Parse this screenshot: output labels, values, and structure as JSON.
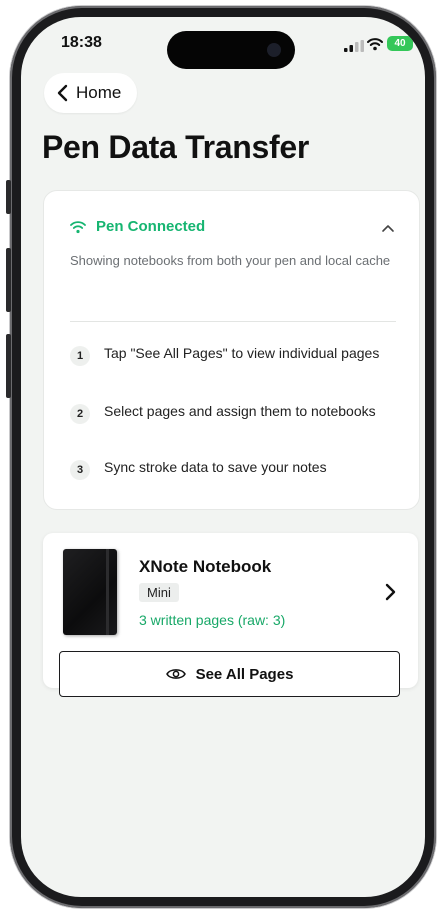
{
  "status_bar": {
    "time": "18:38",
    "battery": "40"
  },
  "header": {
    "back_label": "Home",
    "title": "Pen Data Transfer"
  },
  "connection_card": {
    "status_label": "Pen Connected",
    "status_color": "#16b571",
    "description": "Showing notebooks from both your pen and local cache",
    "steps": [
      {
        "number": "1",
        "text": "Tap \"See All Pages\" to view individual pages"
      },
      {
        "number": "2",
        "text": "Select pages and assign them to notebooks"
      },
      {
        "number": "3",
        "text": "Sync stroke data to save your notes"
      }
    ]
  },
  "notebook": {
    "title": "XNote Notebook",
    "size_badge": "Mini",
    "pages_info": "3 written pages (raw: 3)",
    "see_all_label": "See All Pages"
  },
  "icons": {
    "back": "chevron-left-icon",
    "wifi": "wifi-icon",
    "collapse": "chevron-up-icon",
    "open_notebook": "chevron-right-icon",
    "view": "eye-icon"
  }
}
